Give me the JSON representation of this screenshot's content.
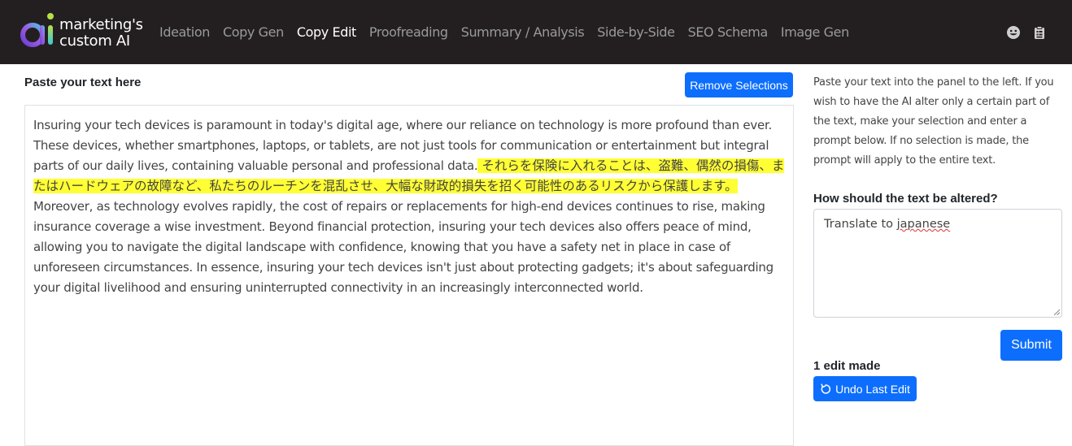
{
  "brand": {
    "logo_mark": "ai",
    "line1": "marketing's",
    "line2": "custom AI"
  },
  "nav": {
    "items": [
      {
        "label": "Ideation",
        "active": false
      },
      {
        "label": "Copy Gen",
        "active": false
      },
      {
        "label": "Copy Edit",
        "active": true
      },
      {
        "label": "Proofreading",
        "active": false
      },
      {
        "label": "Summary / Analysis",
        "active": false
      },
      {
        "label": "Side-by-Side",
        "active": false
      },
      {
        "label": "SEO Schema",
        "active": false
      },
      {
        "label": "Image Gen",
        "active": false
      }
    ],
    "icons": [
      "smiley-face-icon",
      "clipboard-icon"
    ]
  },
  "editor": {
    "title": "Paste your text here",
    "remove_label": "Remove Selections",
    "text_before": "Insuring your tech devices is paramount in today's digital age, where our reliance on technology is more profound than ever. These devices, whether smartphones, laptops, or tablets, are not just tools for communication or entertainment but integral parts of our daily lives, containing valuable personal and professional data.",
    "text_highlight": " それらを保険に入れることは、盗難、偶然の損傷、またはハードウェアの故障など、私たちのルーチンを混乱させ、大幅な財政的損失を招く可能性のあるリスクから保護します。 ",
    "text_after": " Moreover, as technology evolves rapidly, the cost of repairs or replacements for high-end devices continues to rise, making insurance coverage a wise investment. Beyond financial protection, insuring your tech devices also offers peace of mind, allowing you to navigate the digital landscape with confidence, knowing that you have a safety net in place in case of unforeseen circumstances. In essence, insuring your tech devices isn't just about protecting gadgets; it's about safeguarding your digital livelihood and ensuring uninterrupted connectivity in an increasingly interconnected world.",
    "highlight_color": "#ffff33"
  },
  "sidebar": {
    "help_text": "Paste your text into the panel to the left. If you wish to have the AI alter only a certain part of the text, make your selection and enter a prompt below. If no selection is made, the prompt will apply to the entire text.",
    "prompt_label": "How should the text be altered?",
    "prompt_word1": "Translate to ",
    "prompt_word2": "japanese",
    "submit_label": "Submit",
    "edits_made": "1 edit made",
    "undo_label": "Undo Last Edit"
  },
  "colors": {
    "navbar": "#231f20",
    "primary": "#0d6efd",
    "nav_inactive": "#9a9a9a",
    "nav_active": "#ffffff"
  }
}
